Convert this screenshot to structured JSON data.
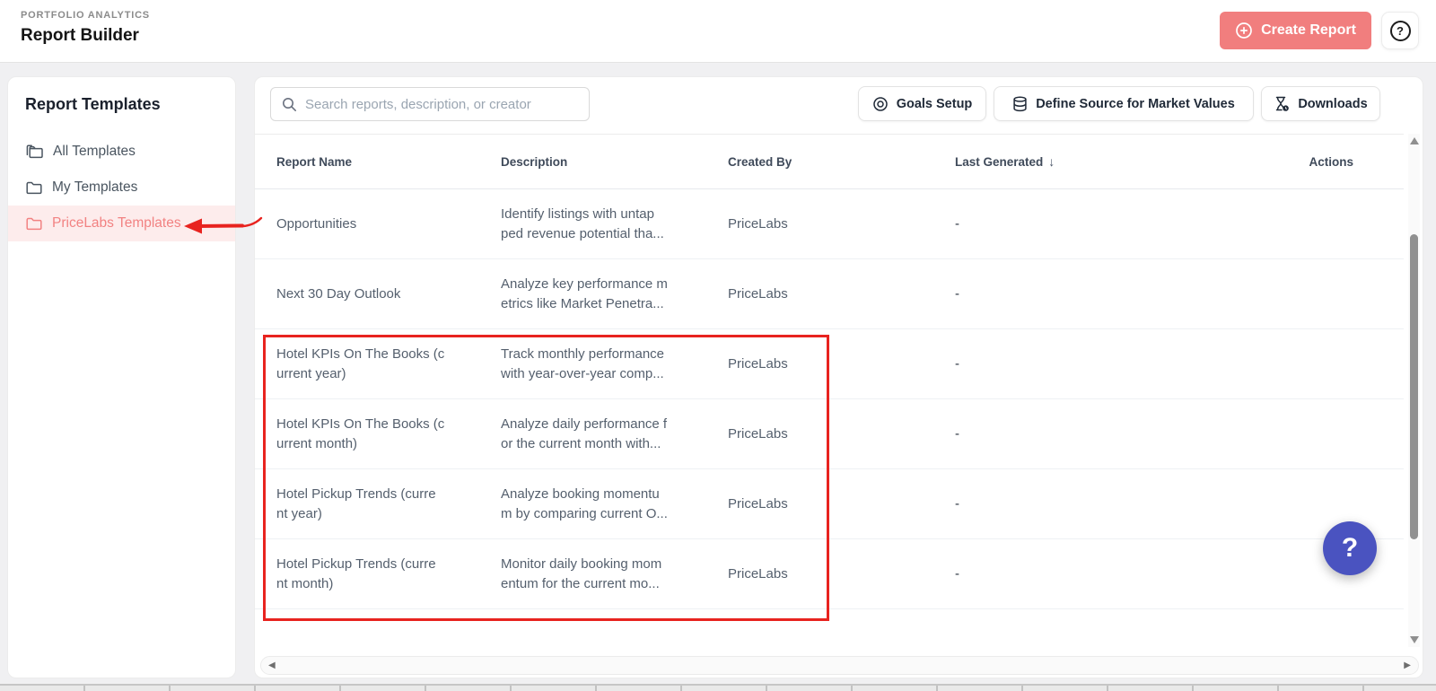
{
  "header": {
    "eyebrow": "PORTFOLIO ANALYTICS",
    "title": "Report Builder",
    "create_report_label": "Create Report"
  },
  "sidebar": {
    "title": "Report Templates",
    "items": [
      {
        "label": "All Templates",
        "icon": "folders-icon",
        "selected": false
      },
      {
        "label": "My Templates",
        "icon": "folder-icon",
        "selected": false
      },
      {
        "label": "PriceLabs Templates",
        "icon": "folder-icon",
        "selected": true
      }
    ]
  },
  "toolbar": {
    "search_placeholder": "Search reports, description, or creator",
    "goals_setup_label": "Goals Setup",
    "define_source_label": "Define Source for Market Values",
    "downloads_label": "Downloads"
  },
  "table": {
    "columns": [
      "Report Name",
      "Description",
      "Created By",
      "Last Generated",
      "Actions"
    ],
    "sort": {
      "column": "Last Generated",
      "direction": "desc",
      "glyph": "↓"
    },
    "rows": [
      {
        "name": "Opportunities",
        "description": "Identify listings with untap\nped revenue potential tha...",
        "created_by": "PriceLabs",
        "last_generated": "-"
      },
      {
        "name": "Next 30 Day Outlook",
        "description": "Analyze key performance m\netrics like Market Penetra...",
        "created_by": "PriceLabs",
        "last_generated": "-"
      },
      {
        "name": "Hotel KPIs On The Books (c\nurrent year)",
        "description": "Track monthly performance\nwith year-over-year comp...",
        "created_by": "PriceLabs",
        "last_generated": "-"
      },
      {
        "name": "Hotel KPIs On The Books (c\nurrent month)",
        "description": "Analyze daily performance f\nor the current month with...",
        "created_by": "PriceLabs",
        "last_generated": "-"
      },
      {
        "name": "Hotel Pickup Trends (curre\nnt year)",
        "description": "Analyze booking momentu\nm by comparing current O...",
        "created_by": "PriceLabs",
        "last_generated": "-"
      },
      {
        "name": "Hotel Pickup Trends (curre\nnt month)",
        "description": "Monitor daily booking mom\nentum for the current mo...",
        "created_by": "PriceLabs",
        "last_generated": "-"
      }
    ]
  },
  "floating_help": {
    "label": "?"
  },
  "colors": {
    "accent": "#f17e7e",
    "accent_selected_bg": "#fdecec",
    "annotation_red": "#e8231f",
    "help_blue": "#4a53c0"
  }
}
